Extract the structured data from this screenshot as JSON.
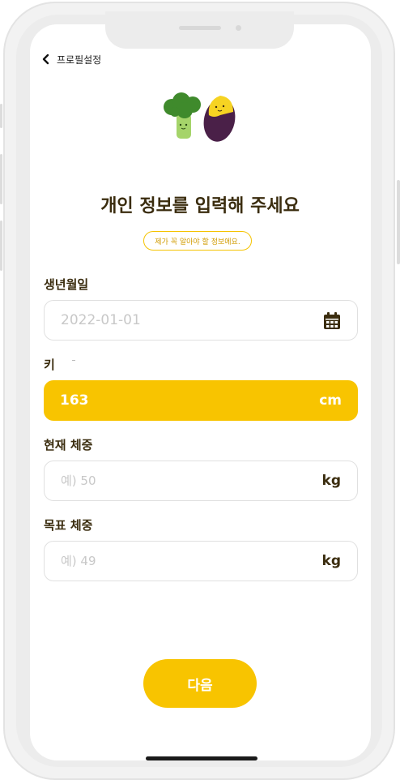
{
  "header": {
    "back_label": "프로필설정"
  },
  "title": "개인 정보를 입력해 주세요",
  "badge": "제가 꼭 알아야 할 정보에요.",
  "birth": {
    "label": "생년월일",
    "placeholder": "2022-01-01"
  },
  "height": {
    "label": "키",
    "value": "163",
    "unit": "cm"
  },
  "current_weight": {
    "label": "현재 체중",
    "placeholder": "예) 50",
    "unit": "kg"
  },
  "target_weight": {
    "label": "목표 체중",
    "placeholder": "예) 49",
    "unit": "kg"
  },
  "next_button": "다음",
  "colors": {
    "accent": "#f8c400",
    "title": "#3b2d0f",
    "placeholder": "#c8c8c8"
  },
  "icons": [
    "chevron-left-icon",
    "calendar-icon",
    "broccoli-illustration",
    "sweet-potato-illustration"
  ]
}
